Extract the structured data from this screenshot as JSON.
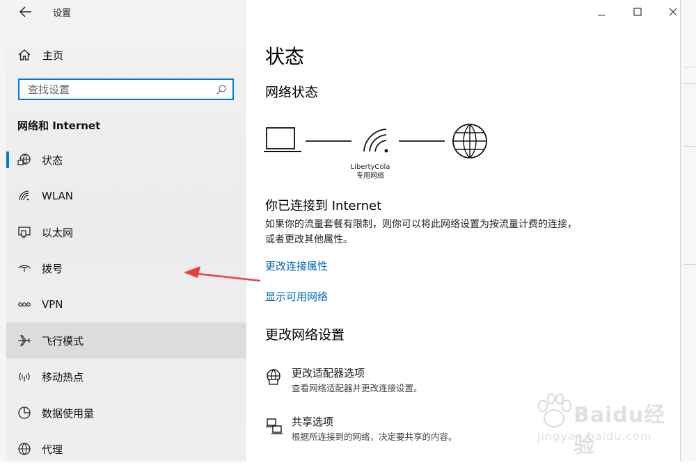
{
  "window": {
    "title": "设置"
  },
  "sidebar": {
    "home_label": "主页",
    "search_placeholder": "查找设置",
    "section_title": "网络和 Internet",
    "items": [
      {
        "label": "状态",
        "icon": "status-globe-icon"
      },
      {
        "label": "WLAN",
        "icon": "wifi-icon"
      },
      {
        "label": "以太网",
        "icon": "ethernet-icon"
      },
      {
        "label": "拨号",
        "icon": "dialup-icon"
      },
      {
        "label": "VPN",
        "icon": "vpn-icon"
      },
      {
        "label": "飞行模式",
        "icon": "airplane-icon"
      },
      {
        "label": "移动热点",
        "icon": "hotspot-icon"
      },
      {
        "label": "数据使用量",
        "icon": "data-usage-icon"
      },
      {
        "label": "代理",
        "icon": "proxy-globe-icon"
      }
    ],
    "active_item": "状态",
    "hover_item": "飞行模式"
  },
  "content": {
    "page_title": "状态",
    "network_status_heading": "网络状态",
    "network_name": "LibertyCola",
    "network_type": "专用网络",
    "connected_heading": "你已连接到 Internet",
    "connected_desc": "如果你的流量套餐有限制，则你可以将此网络设置为按流量计费的连接，或者更改其他属性。",
    "link_change_properties": "更改连接属性",
    "link_show_networks": "显示可用网络",
    "change_settings_heading": "更改网络设置",
    "options": [
      {
        "title": "更改适配器选项",
        "desc": "查看网络适配器并更改连接设置。",
        "icon": "adapter-globe-icon"
      },
      {
        "title": "共享选项",
        "desc": "根据所连接到的网络，决定要共享的内容。",
        "icon": "sharing-icon"
      }
    ]
  },
  "watermark": {
    "brand": "Baidu经验",
    "url": "jingyan.baidu.com"
  },
  "colors": {
    "accent": "#0078d7",
    "link": "#0067b8",
    "arrow": "#e8403a"
  }
}
